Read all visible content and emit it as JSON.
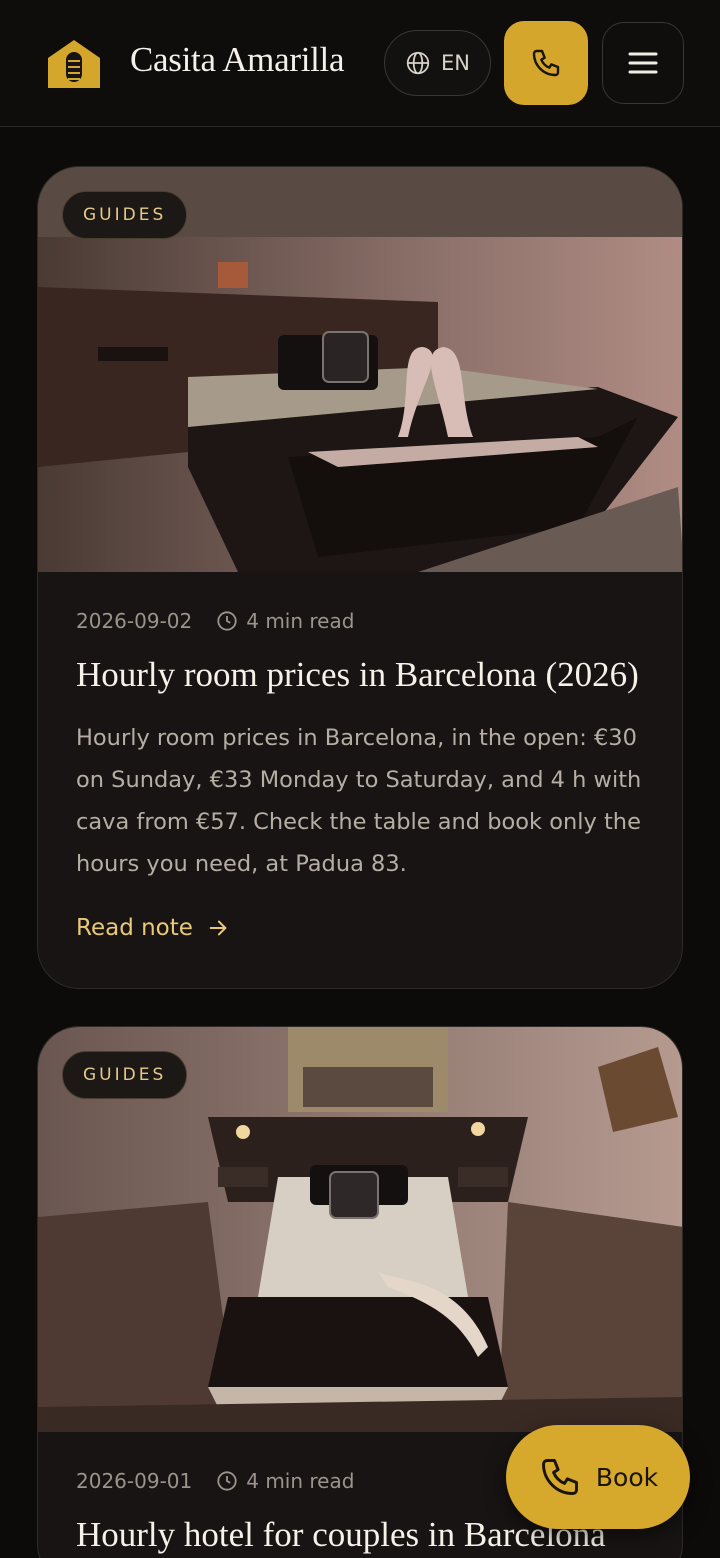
{
  "header": {
    "brand": "Casita Amarilla",
    "language": "EN",
    "icons": {
      "logo": "house-logo-icon",
      "language": "globe-icon",
      "call": "phone-icon",
      "menu": "hamburger-menu-icon"
    }
  },
  "colors": {
    "accent": "#d4a72c",
    "background": "#0c0b0a",
    "card": "#171413",
    "link": "#e9c878"
  },
  "posts": [
    {
      "category": "GUIDES",
      "date": "2026-09-02",
      "read_time": "4 min read",
      "title": "Hourly room prices in Barcelona (2026)",
      "excerpt": "Hourly room prices in Barcelona, in the open: €30 on Sunday, €33 Monday to Saturday, and 4 h with cava from €57. Check the table and book only the hours you need, at Padua 83.",
      "cta": "Read note"
    },
    {
      "category": "GUIDES",
      "date": "2026-09-01",
      "read_time": "4 min read",
      "title": "Hourly hotel for couples in Barcelona"
    }
  ],
  "book_button": {
    "label": "Book"
  }
}
